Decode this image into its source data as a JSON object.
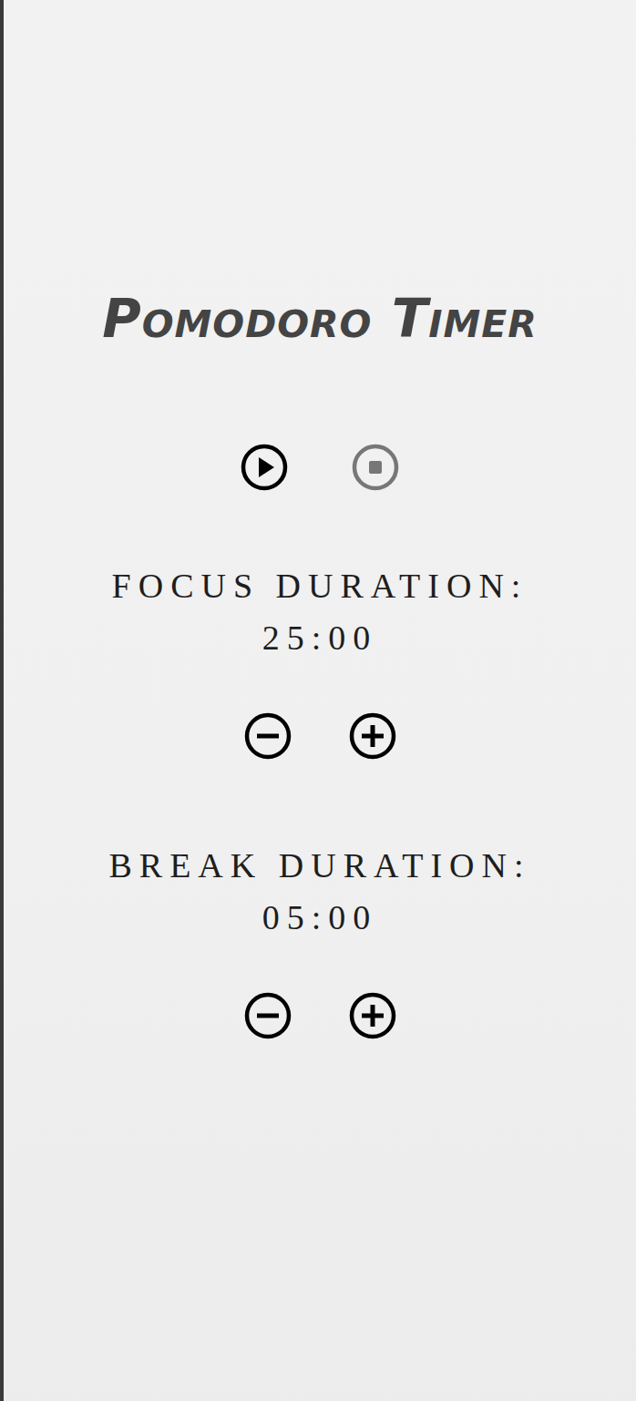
{
  "title": "Pomodoro Timer",
  "controls": [
    {
      "kind": "play",
      "disabled": false
    },
    {
      "kind": "stop",
      "disabled": true
    }
  ],
  "sections": [
    {
      "name": "focus",
      "label": "FOCUS DURATION:",
      "value": "25:00"
    },
    {
      "name": "break",
      "label": "BREAK DURATION:",
      "value": "05:00"
    }
  ]
}
